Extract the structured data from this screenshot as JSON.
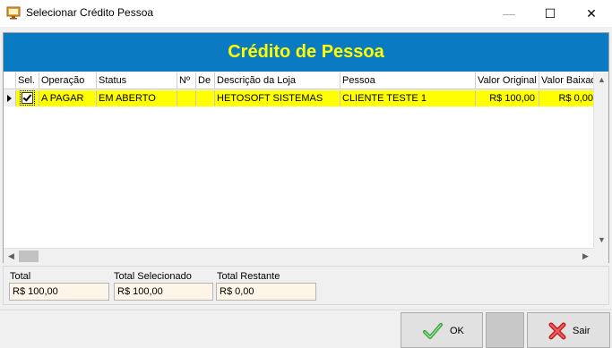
{
  "window": {
    "title": "Selecionar Crédito Pessoa",
    "minimize_glyph": "—",
    "maximize_glyph": "☐",
    "close_glyph": "✕"
  },
  "banner": {
    "title": "Crédito de Pessoa"
  },
  "grid": {
    "columns": [
      "Sel.",
      "Operação",
      "Status",
      "Nº",
      "De",
      "Descrição da Loja",
      "Pessoa",
      "Valor Original",
      "Valor Baixado"
    ],
    "rows": [
      {
        "selected": true,
        "operacao": "A PAGAR",
        "status": "EM ABERTO",
        "numero": "",
        "de": "",
        "descricao_loja": "HETOSOFT SISTEMAS",
        "pessoa": "CLIENTE TESTE 1",
        "valor_original": "R$ 100,00",
        "valor_baixado": "R$ 0,00"
      }
    ]
  },
  "totals": {
    "total_label": "Total",
    "total_value": "R$ 100,00",
    "selecionado_label": "Total Selecionado",
    "selecionado_value": "R$ 100,00",
    "restante_label": "Total Restante",
    "restante_value": "R$ 0,00"
  },
  "buttons": {
    "ok_label": "OK",
    "sair_label": "Sair"
  },
  "colors": {
    "banner_bg": "#0a7bc2",
    "banner_text": "#ffff00",
    "selected_row": "#ffff00",
    "field_bg": "#fdf6e8"
  }
}
